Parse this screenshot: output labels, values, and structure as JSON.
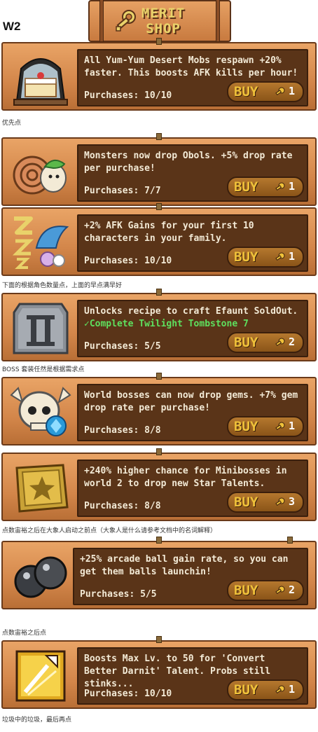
{
  "header": {
    "page_label": "W2",
    "sign_title": "MERIT\nSHOP"
  },
  "buy_label": "BUY",
  "items": [
    {
      "desc": "All Yum-Yum Desert Mobs respawn +20% faster. This boosts AFK kills per hour!",
      "requirement": "",
      "purchases": "Purchases: 10/10",
      "cost": "1",
      "icon": "cake-jar-icon"
    },
    {
      "desc": "Monsters now drop Obols. +5% drop rate per purchase!",
      "requirement": "",
      "purchases": "Purchases: 7/7",
      "cost": "1",
      "icon": "snail-obol-icon"
    },
    {
      "desc": "+2% AFK Gains for your first 10 characters in your family.",
      "requirement": "",
      "purchases": "Purchases: 10/10",
      "cost": "1",
      "icon": "sleep-z-icon"
    },
    {
      "desc": "Unlocks recipe to craft Efaunt SoldOut.",
      "requirement": "Complete Twilight Tombstone 7",
      "purchases": "Purchases: 5/5",
      "cost": "2",
      "icon": "stone-tablet-icon"
    },
    {
      "desc": "World bosses can now drop gems. +7% gem drop rate per purchase!",
      "requirement": "",
      "purchases": "Purchases: 8/8",
      "cost": "1",
      "icon": "skull-gem-icon"
    },
    {
      "desc": "+240% higher chance for Minibosses in world 2 to drop new Star Talents.",
      "requirement": "",
      "purchases": "Purchases: 8/8",
      "cost": "3",
      "icon": "star-book-icon"
    },
    {
      "desc": "+25% arcade ball gain rate, so you can get them balls launchin!",
      "requirement": "",
      "purchases": "Purchases: 5/5",
      "cost": "2",
      "icon": "arcade-balls-icon"
    },
    {
      "desc": "Boosts Max Lv. to 50 for 'Convert Better Darnit' Talent. Probs still stinks...",
      "requirement": "",
      "purchases": "Purchases: 10/10",
      "cost": "1",
      "icon": "talent-arrow-icon"
    }
  ],
  "notes": [
    "优先点",
    "下面的根据角色数量点，上面的早点满早好",
    "BOSS 套装任然是根据需求点",
    "点数宙裕之后在大象人启动之前点（大象人是什么请参考文档中的名词解释）",
    "点数宙裕之后点",
    "垃圾中的垃圾，最后再点"
  ],
  "colors": {
    "wood": "#d3864a",
    "panel": "#5a3418",
    "text": "#f3ead6",
    "buy_text": "#f0c23a",
    "req_green": "#5ee05e"
  }
}
